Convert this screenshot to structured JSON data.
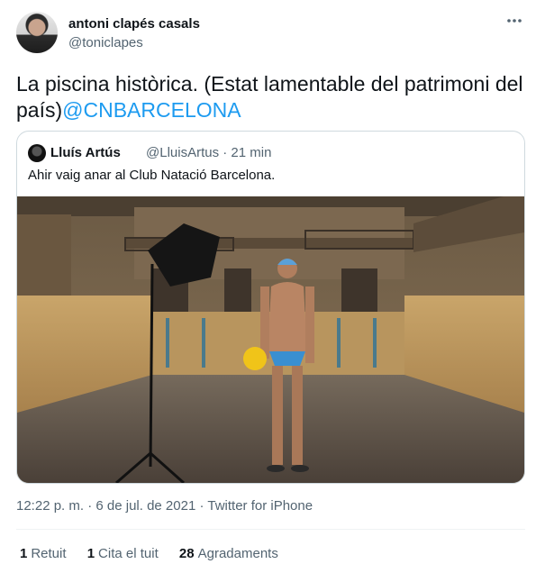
{
  "author": {
    "name": "antoni clapés casals",
    "handle": "@toniclapes"
  },
  "tweet": {
    "text": "La piscina històrica. (Estat lamentable del patrimoni del país)",
    "mention": "@CNBARCELONA"
  },
  "quoted": {
    "name": "Lluís Artús",
    "meta": "@LluisArtus · 21 min",
    "text": "Ahir vaig anar al Club Natació Barcelona."
  },
  "timestamp": "12:22 p. m. · 6 de jul. de 2021 · Twitter for iPhone",
  "stats": [
    {
      "count": "1",
      "label": "Retuit"
    },
    {
      "count": "1",
      "label": "Cita el tuit"
    },
    {
      "count": "28",
      "label": "Agradaments"
    }
  ],
  "colors": {
    "accent": "#1d9bf0",
    "secondary_text": "#536471",
    "border": "#cfd9de"
  },
  "icons": {
    "more": "more-horizontal-icon"
  }
}
